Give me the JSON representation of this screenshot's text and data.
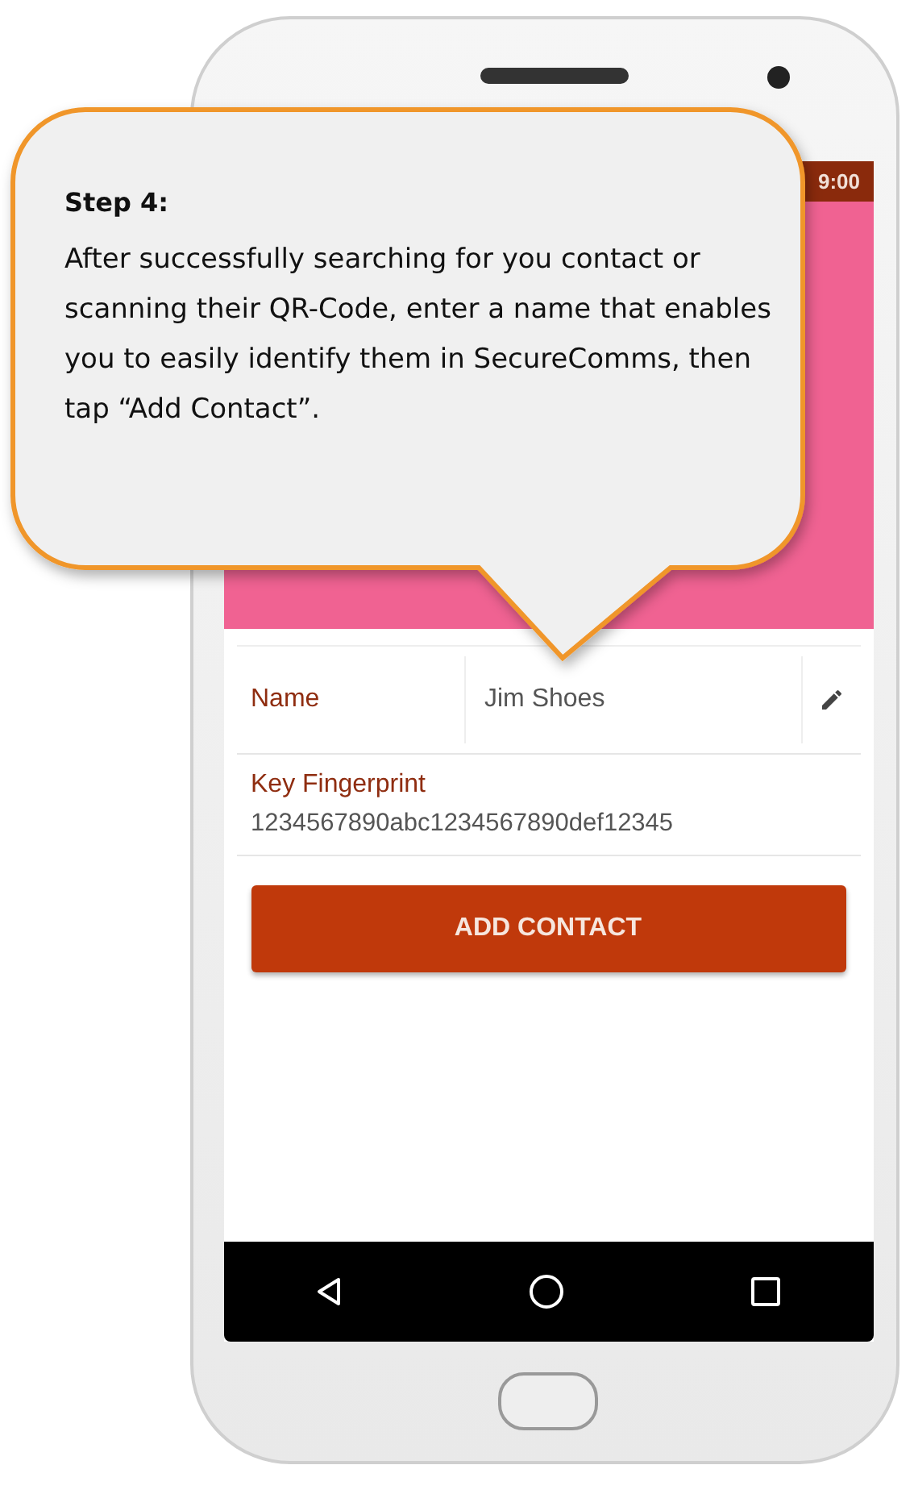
{
  "callout": {
    "title": "Step 4:",
    "body": "After successfully searching for you contact or scanning their QR-Code, enter a name that enables you to easily identify them in SecureComms, then tap “Add Contact”."
  },
  "status_bar": {
    "time": "9:00"
  },
  "form": {
    "name_label": "Name",
    "name_value": "Jim Shoes",
    "fingerprint_label": "Key Fingerprint",
    "fingerprint_value": "1234567890abc1234567890def12345"
  },
  "button": {
    "label": "ADD CONTACT"
  }
}
